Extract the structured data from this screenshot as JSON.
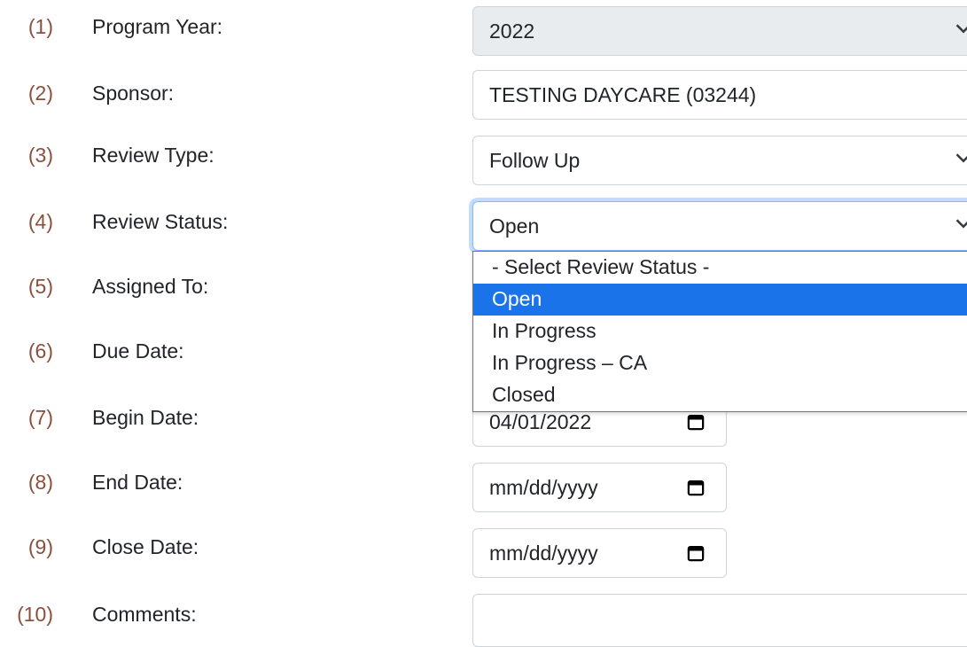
{
  "rows": [
    {
      "num": "(1)",
      "label": "Program Year:"
    },
    {
      "num": "(2)",
      "label": "Sponsor:"
    },
    {
      "num": "(3)",
      "label": "Review Type:"
    },
    {
      "num": "(4)",
      "label": "Review Status:"
    },
    {
      "num": "(5)",
      "label": "Assigned To:"
    },
    {
      "num": "(6)",
      "label": "Due Date:"
    },
    {
      "num": "(7)",
      "label": "Begin Date:"
    },
    {
      "num": "(8)",
      "label": "End Date:"
    },
    {
      "num": "(9)",
      "label": "Close Date:"
    },
    {
      "num": "(10)",
      "label": "Comments:"
    }
  ],
  "fields": {
    "program_year": "2022",
    "sponsor": "TESTING DAYCARE (03244)",
    "review_type": "Follow Up",
    "review_status": "Open",
    "begin_date": "04/01/2022",
    "end_date_placeholder": "mm/dd/yyyy",
    "close_date_placeholder": "mm/dd/yyyy",
    "comments": ""
  },
  "review_status_options": [
    "- Select Review Status -",
    "Open",
    "In Progress",
    "In Progress – CA",
    "Closed"
  ],
  "selected_option_index": 1,
  "colors": {
    "row_number": "#8b4f3d",
    "selected_option_bg": "#1a73e8",
    "focus_ring": "#86b7fe",
    "disabled_bg": "#e9ecef"
  },
  "icons": {
    "select": "chevron-down-icon",
    "date": "calendar-icon"
  }
}
